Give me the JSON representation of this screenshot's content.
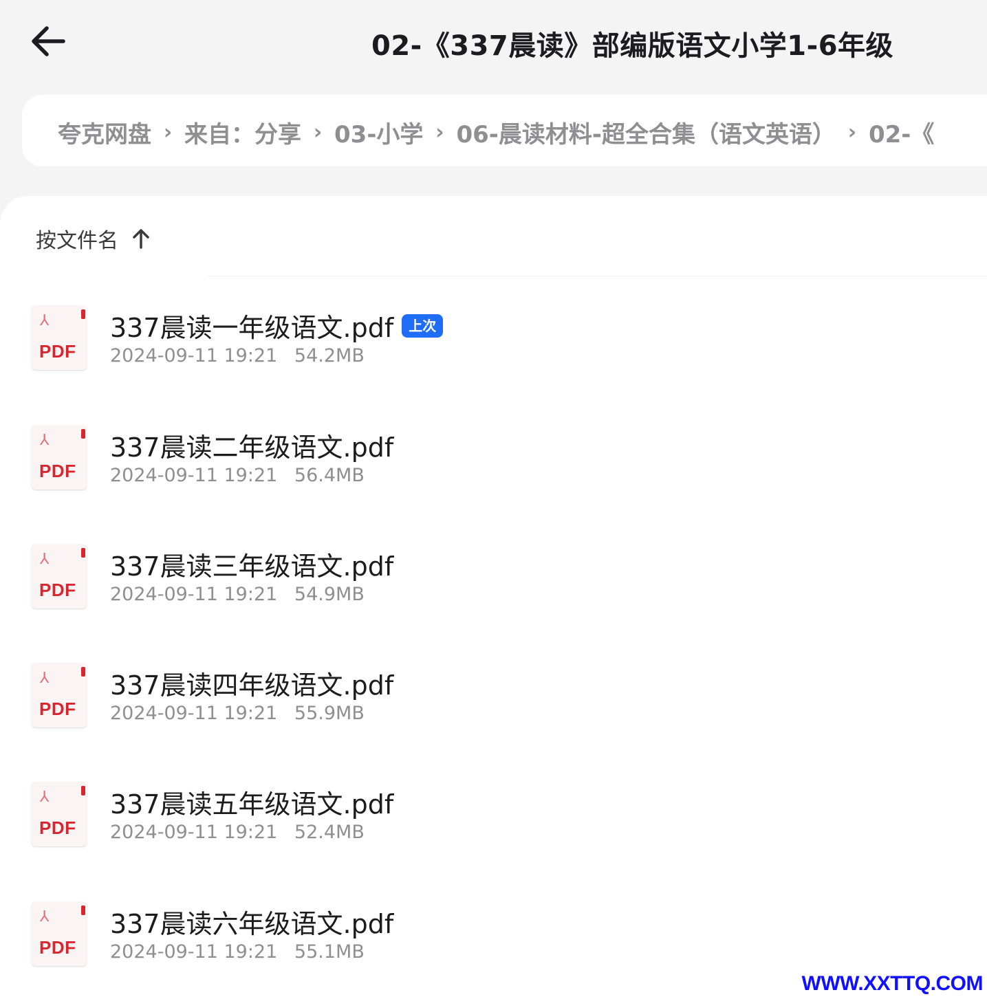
{
  "header": {
    "title": "02-《337晨读》部编版语文小学1-6年级"
  },
  "breadcrumb": {
    "items": [
      "夸克网盘",
      "来自：分享",
      "03-小学",
      "06-晨读材料-超全合集（语文英语）",
      "02-《"
    ]
  },
  "sort": {
    "label": "按文件名"
  },
  "files": [
    {
      "name": "337晨读一年级语文.pdf",
      "date": "2024-09-11 19:21",
      "size": "54.2MB",
      "badge": "上次",
      "icon_label": "PDF"
    },
    {
      "name": "337晨读二年级语文.pdf",
      "date": "2024-09-11 19:21",
      "size": "56.4MB",
      "badge": "",
      "icon_label": "PDF"
    },
    {
      "name": "337晨读三年级语文.pdf",
      "date": "2024-09-11 19:21",
      "size": "54.9MB",
      "badge": "",
      "icon_label": "PDF"
    },
    {
      "name": "337晨读四年级语文.pdf",
      "date": "2024-09-11 19:21",
      "size": "55.9MB",
      "badge": "",
      "icon_label": "PDF"
    },
    {
      "name": "337晨读五年级语文.pdf",
      "date": "2024-09-11 19:21",
      "size": "52.4MB",
      "badge": "",
      "icon_label": "PDF"
    },
    {
      "name": "337晨读六年级语文.pdf",
      "date": "2024-09-11 19:21",
      "size": "55.1MB",
      "badge": "",
      "icon_label": "PDF"
    }
  ],
  "watermark": "WWW.XXTTQ.COM",
  "colors": {
    "accent": "#1f6cf7",
    "pdf_red": "#d9262e",
    "watermark": "#1010ff"
  }
}
